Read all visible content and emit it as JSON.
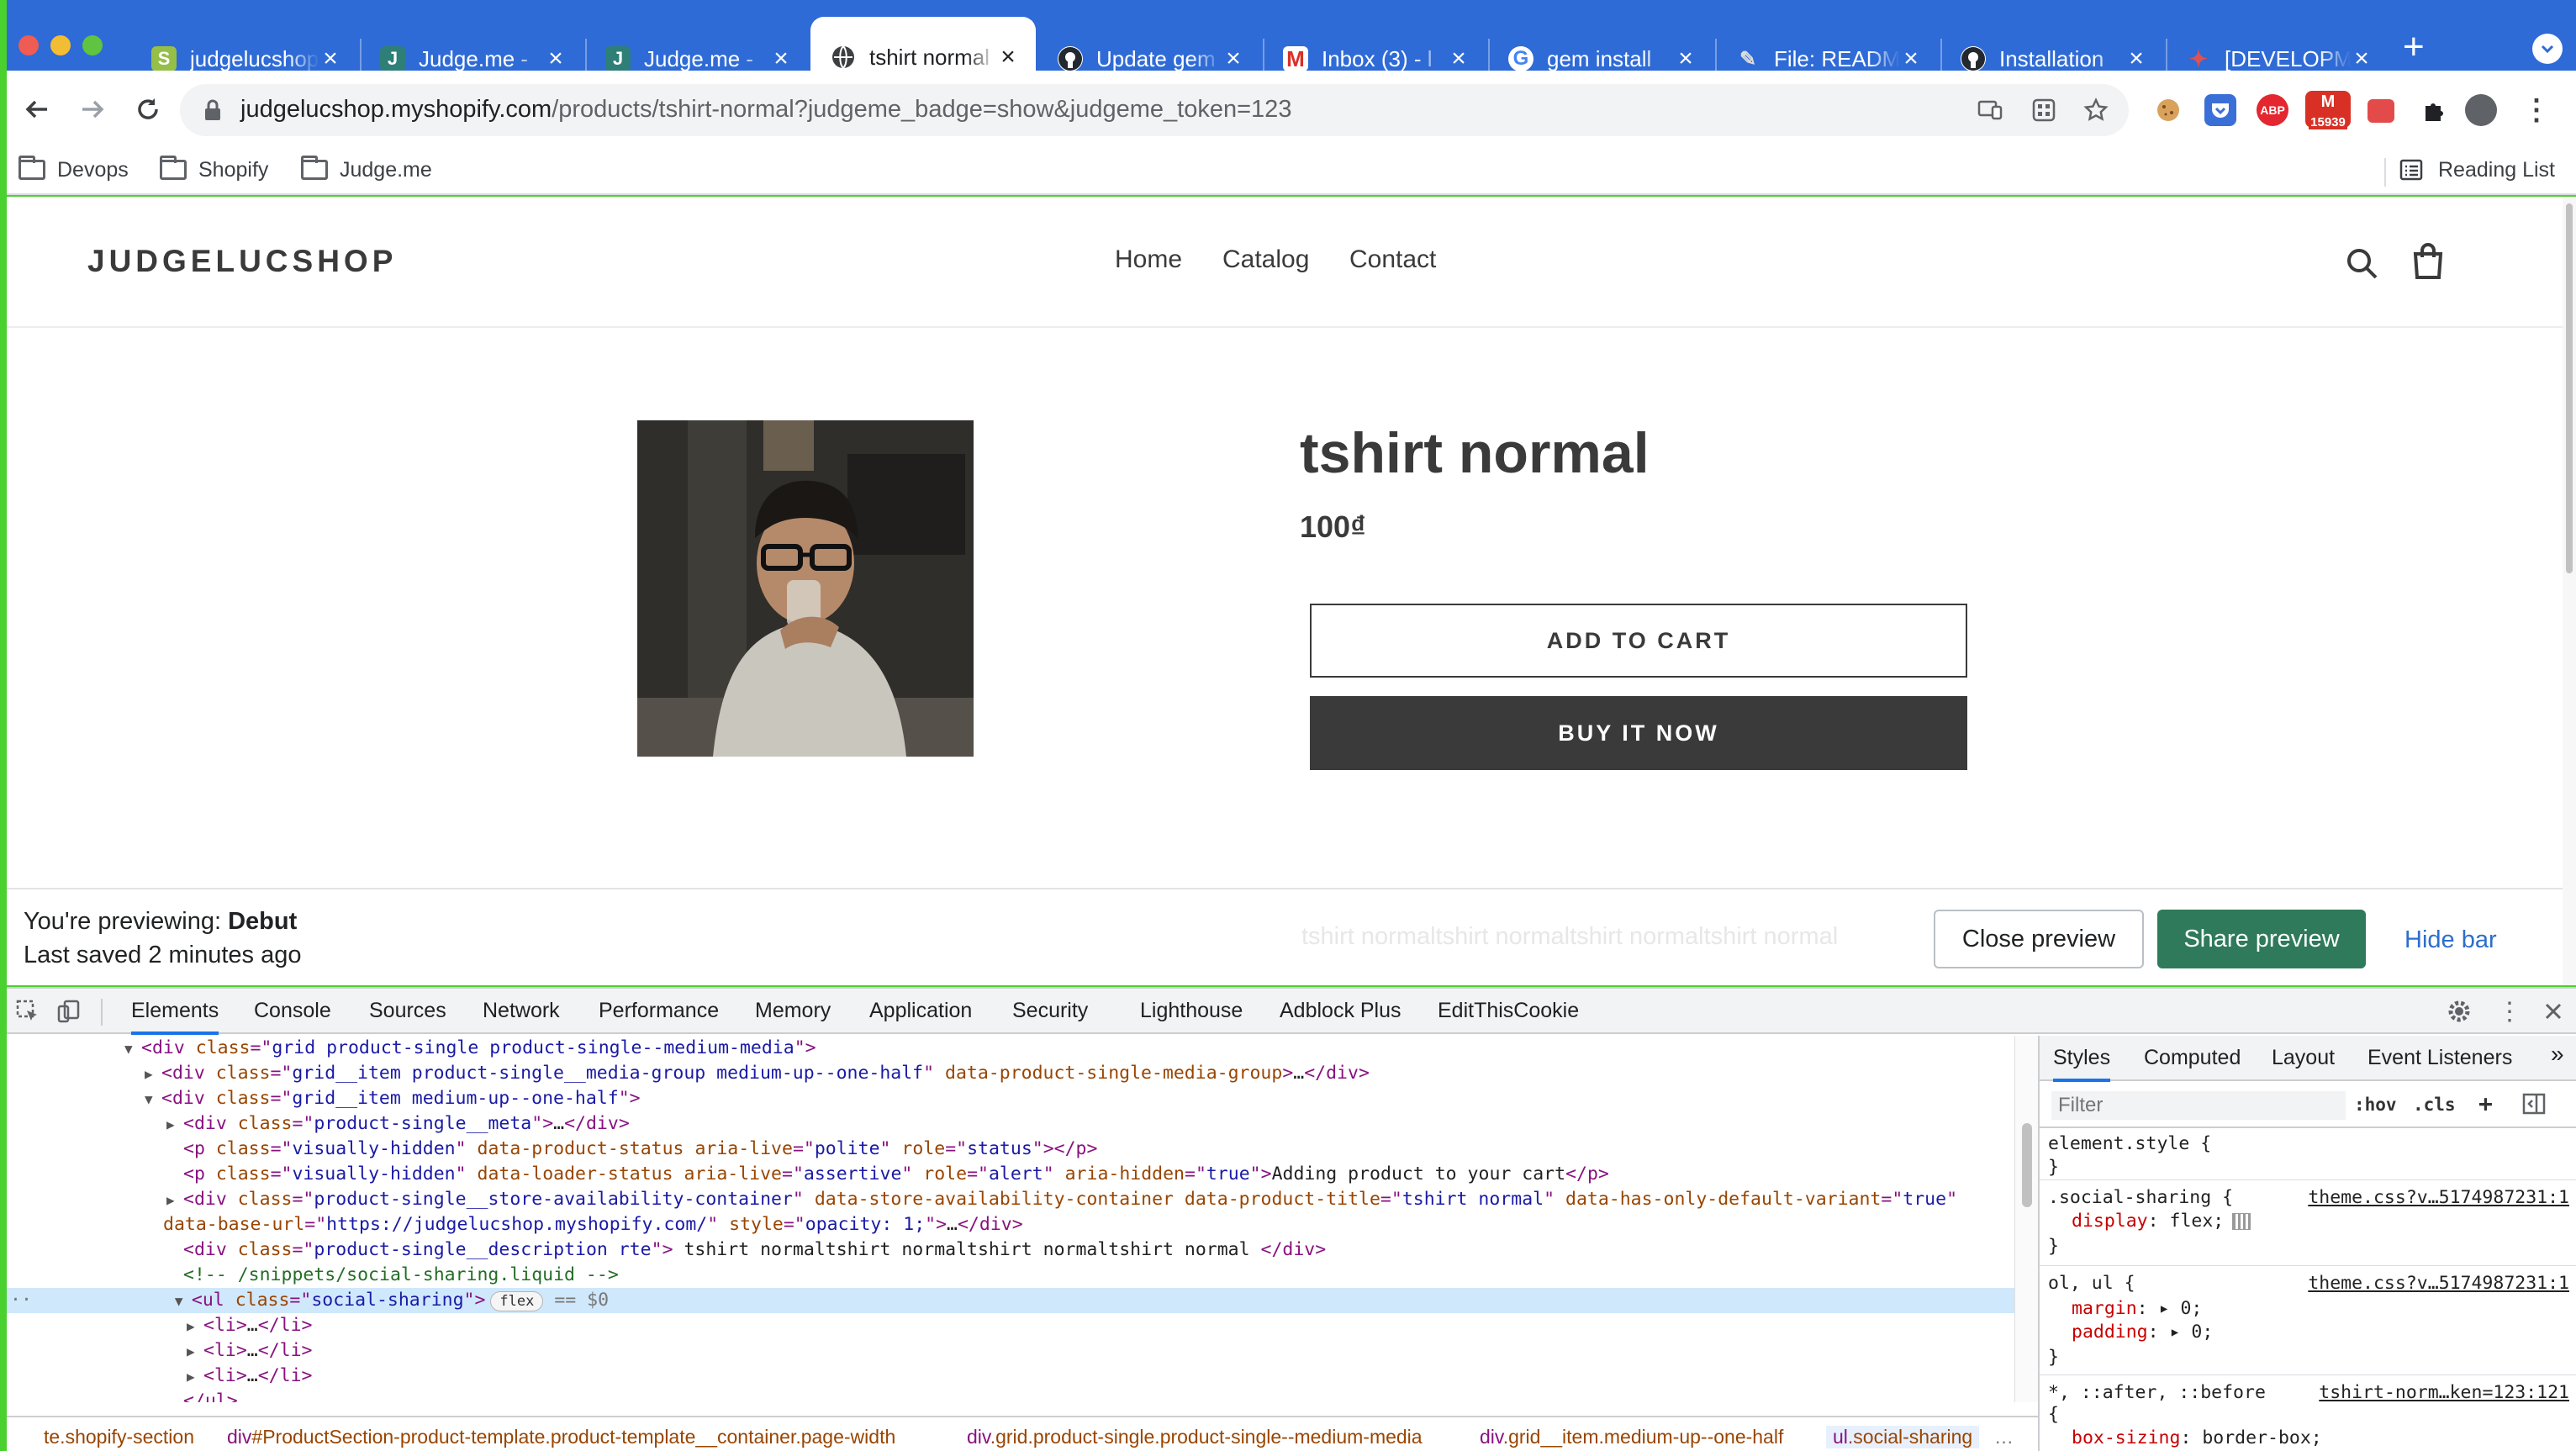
{
  "browser": {
    "tabs": [
      {
        "title": "judgelucshop",
        "favicon": "shopify"
      },
      {
        "title": "Judge.me - ",
        "favicon": "judgeme"
      },
      {
        "title": "Judge.me - ",
        "favicon": "judgeme"
      },
      {
        "title": "tshirt normal",
        "favicon": "globe",
        "active": true
      },
      {
        "title": "Update gem",
        "favicon": "github"
      },
      {
        "title": "Inbox (3) - l",
        "favicon": "gmail"
      },
      {
        "title": "gem install",
        "favicon": "google"
      },
      {
        "title": "File: READM",
        "favicon": "rubydoc"
      },
      {
        "title": "Installation",
        "favicon": "github"
      },
      {
        "title": "[DEVELOPM",
        "favicon": "dev"
      }
    ],
    "tab_close_glyph": "×",
    "new_tab_glyph": "+",
    "url_host": "judgelucshop.myshopify.com",
    "url_path": "/products/tshirt-normal?judgeme_badge=show&judgeme_token=123",
    "extension_badge": "15939",
    "bookmarks": [
      "Devops",
      "Shopify",
      "Judge.me"
    ],
    "reading_list": "Reading List"
  },
  "site": {
    "logo": "JUDGELUCSHOP",
    "nav": [
      "Home",
      "Catalog",
      "Contact"
    ]
  },
  "product": {
    "title": "tshirt normal",
    "price": "100₫",
    "add_to_cart": "ADD TO CART",
    "buy_now": "BUY IT NOW"
  },
  "preview_bar": {
    "previewing_label": "You're previewing: ",
    "theme": "Debut",
    "last_saved": "Last saved 2 minutes ago",
    "ghost_description": "tshirt normaltshirt normaltshirt normaltshirt normal",
    "close_preview": "Close preview",
    "share_preview": "Share preview",
    "hide_bar": "Hide bar"
  },
  "devtools": {
    "tabs": [
      "Elements",
      "Console",
      "Sources",
      "Network",
      "Performance",
      "Memory",
      "Application",
      "Security",
      "Lighthouse",
      "Adblock Plus",
      "EditThisCookie"
    ],
    "dom": {
      "l1_tag": "div",
      "l1_attr": "class",
      "l1_val": "grid product-single product-single--medium-media",
      "l2_val": "grid__item product-single__media-group medium-up--one-half",
      "l2_attr2": "data-product-single-media-group",
      "l3_val": "grid__item medium-up--one-half",
      "l4_val": "product-single__meta",
      "l5_val": "visually-hidden",
      "l5_attr2": "data-product-status",
      "l5_attr3": "aria-live",
      "l5_val3": "polite",
      "l5_attr4": "role",
      "l5_val4": "status",
      "l6_val": "visually-hidden",
      "l6_attr2": "data-loader-status",
      "l6_attr3": "aria-live",
      "l6_val3": "assertive",
      "l6_attr4": "role",
      "l6_val4": "alert",
      "l6_attr5": "aria-hidden",
      "l6_val5": "true",
      "l6_text": "Adding product to your cart",
      "l7_val": "product-single__store-availability-container",
      "l7_attr2": "data-store-availability-container",
      "l7_attr3": "data-product-title",
      "l7_val3": "tshirt normal",
      "l7_attr4": "data-has-only-default-variant",
      "l7_val4": "true",
      "l8_attr": "data-base-url",
      "l8_val": "https://judgelucshop.myshopify.com/",
      "l8_attr2": "style",
      "l8_val2": "opacity: 1;",
      "l9_val": "product-single__description rte",
      "l9_text": " tshirt normaltshirt normaltshirt normaltshirt normal ",
      "l10_comment": "<!-- /snippets/social-sharing.liquid -->",
      "l11_tag": "ul",
      "l11_val": "social-sharing",
      "l11_badge": "flex",
      "l11_eq": "== $0",
      "li": "li",
      "ul_close": "</ul>"
    },
    "breadcrumbs": [
      {
        "el": "",
        "cls": "te.shopify-section"
      },
      {
        "el": "div",
        "cls": "#ProductSection-product-template.product-template__container.page-width"
      },
      {
        "el": "div",
        "cls": ".grid.product-single.product-single--medium-media"
      },
      {
        "el": "div",
        "cls": ".grid__item.medium-up--one-half"
      },
      {
        "el": "ul",
        "cls": ".social-sharing"
      }
    ],
    "styles_tabs": [
      "Styles",
      "Computed",
      "Layout",
      "Event Listeners"
    ],
    "filter_placeholder": "Filter",
    "hov": ":hov",
    "cls": ".cls",
    "rules": [
      {
        "selector": "element.style {",
        "props": [],
        "close": "}",
        "source": ""
      },
      {
        "selector": ".social-sharing {",
        "props": [
          {
            "name": "display",
            "value": "flex;"
          }
        ],
        "close": "}",
        "source": "theme.css?v…5174987231:1"
      },
      {
        "selector": "ol, ul {",
        "props": [
          {
            "name": "margin",
            "value": "▸ 0;"
          },
          {
            "name": "padding",
            "value": "▸ 0;"
          }
        ],
        "close": "}",
        "source": "theme.css?v…5174987231:1"
      },
      {
        "selector": "*, ::after, ::before",
        "props": [
          {
            "name": "box-sizing",
            "value": "border-box;"
          }
        ],
        "close": "{",
        "source": "tshirt-norm…ken=123:121"
      }
    ]
  }
}
